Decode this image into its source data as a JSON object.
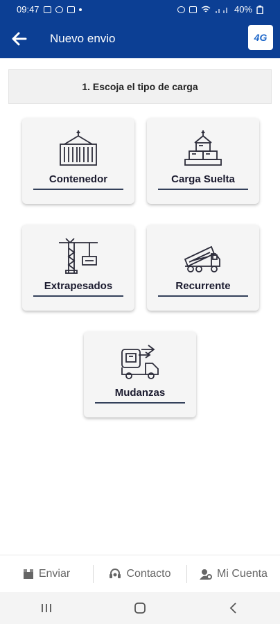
{
  "status_bar": {
    "time": "09:47",
    "battery": "40%"
  },
  "app_bar": {
    "title": "Nuevo envio",
    "logo_text": "4G"
  },
  "step": {
    "text": "1. Escoja el tipo de carga"
  },
  "cargo_options": [
    {
      "label": "Contenedor",
      "icon": "container-crane-icon"
    },
    {
      "label": "Carga Suelta",
      "icon": "loose-boxes-icon"
    },
    {
      "label": "Extrapesados",
      "icon": "tower-crane-icon"
    },
    {
      "label": "Recurrente",
      "icon": "dump-truck-icon"
    },
    {
      "label": "Mudanzas",
      "icon": "moving-truck-icon"
    }
  ],
  "bottom_nav": [
    {
      "label": "Enviar",
      "icon": "box-icon"
    },
    {
      "label": "Contacto",
      "icon": "headset-icon"
    },
    {
      "label": "Mi Cuenta",
      "icon": "user-gear-icon"
    }
  ],
  "colors": {
    "primary": "#0c3f94",
    "card_bg": "#f5f5f5",
    "nav_text": "#666666"
  }
}
